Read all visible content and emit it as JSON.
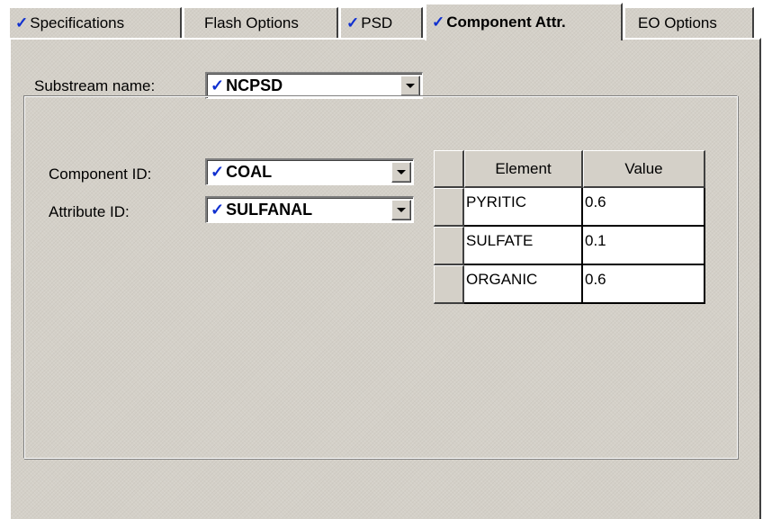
{
  "tabs": [
    {
      "label": "Specifications",
      "checked": true,
      "active": false
    },
    {
      "label": "Flash Options",
      "checked": false,
      "active": false
    },
    {
      "label": "PSD",
      "checked": true,
      "active": false
    },
    {
      "label": "Component Attr.",
      "checked": true,
      "active": true
    },
    {
      "label": "EO Options",
      "checked": false,
      "active": false
    }
  ],
  "check_glyph": "✓",
  "substream": {
    "label": "Substream name:",
    "value": "NCPSD"
  },
  "component": {
    "label": "Component ID:",
    "value": "COAL"
  },
  "attribute": {
    "label": "Attribute ID:",
    "value": "SULFANAL"
  },
  "grid": {
    "headers": [
      "Element",
      "Value"
    ],
    "rows": [
      {
        "element": "PYRITIC",
        "value": "0.6"
      },
      {
        "element": "SULFATE",
        "value": "0.1"
      },
      {
        "element": "ORGANIC",
        "value": "0.6"
      }
    ]
  },
  "colors": {
    "face": "#d4d0c8",
    "check": "#1030d0",
    "shadow": "#404040"
  }
}
